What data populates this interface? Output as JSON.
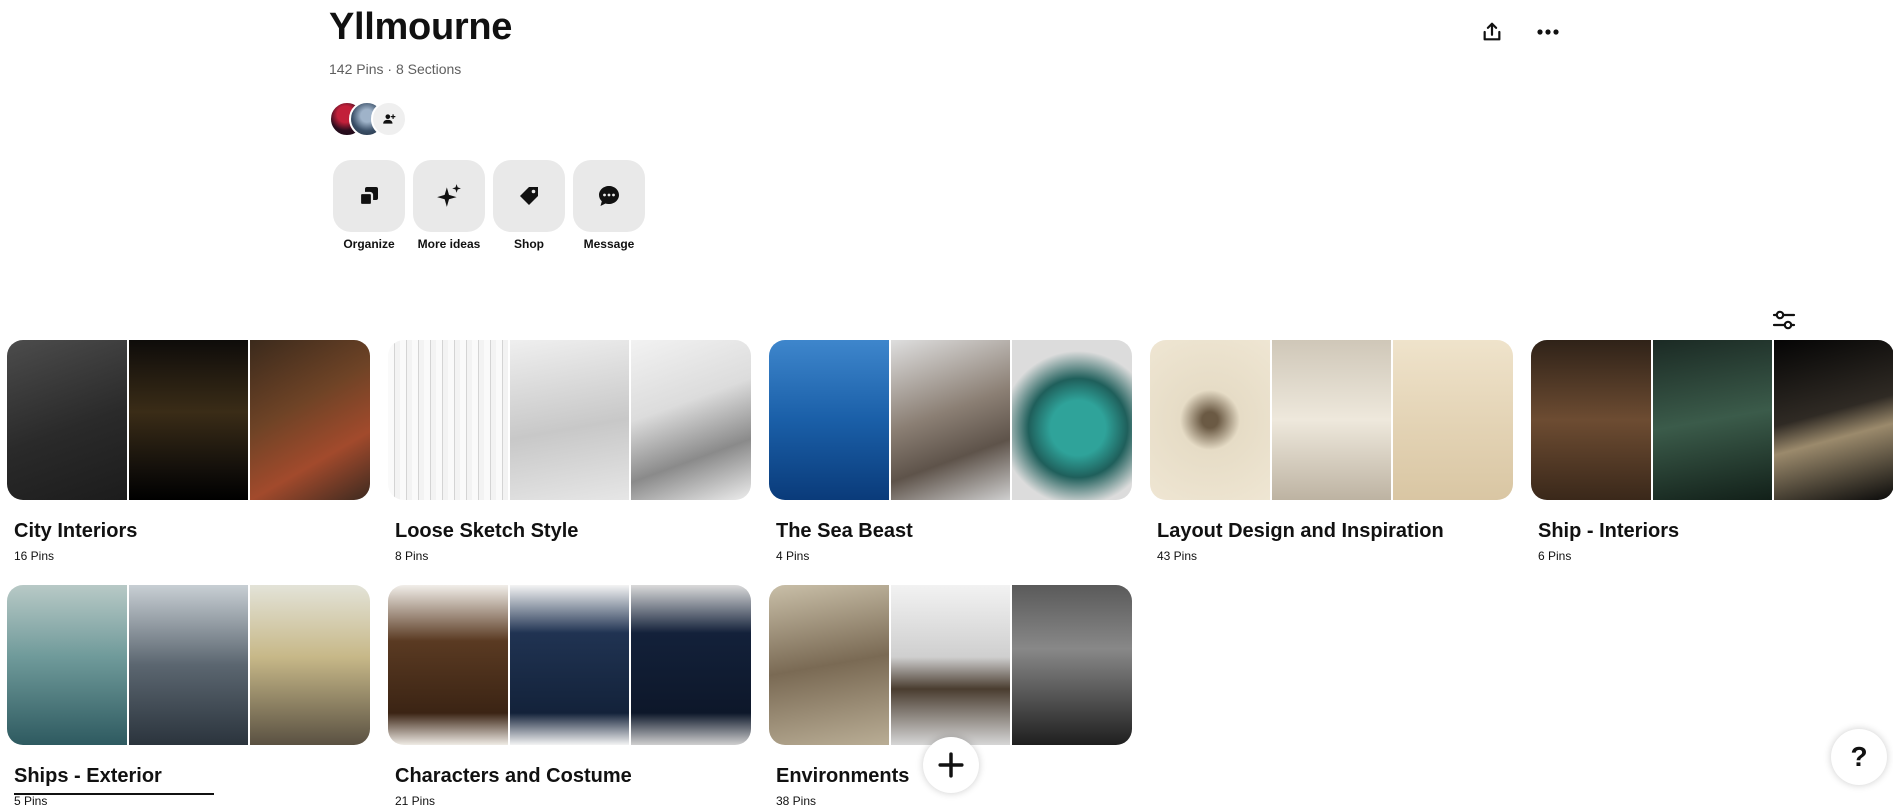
{
  "board": {
    "title": "Yllmourne",
    "pins_count": "142 Pins",
    "separator": "·",
    "sections_count": "8 Sections"
  },
  "header_icons": {
    "share": "share-icon",
    "more": "more-icon"
  },
  "tools": [
    {
      "label": "Organize",
      "icon": "organize-icon"
    },
    {
      "label": "More ideas",
      "icon": "sparkle-icon"
    },
    {
      "label": "Shop",
      "icon": "tag-icon"
    },
    {
      "label": "Message",
      "icon": "message-icon"
    }
  ],
  "sections": [
    {
      "title": "City Interiors",
      "count": "16 Pins"
    },
    {
      "title": "Loose Sketch Style",
      "count": "8 Pins"
    },
    {
      "title": "The Sea Beast",
      "count": "4 Pins"
    },
    {
      "title": "Layout Design and Inspiration",
      "count": "43 Pins"
    },
    {
      "title": "Ship - Interiors",
      "count": "6 Pins"
    },
    {
      "title": "Ships - Exterior",
      "count": "5 Pins"
    },
    {
      "title": "Characters and Costume",
      "count": "21 Pins"
    },
    {
      "title": "Environments",
      "count": "38 Pins"
    }
  ],
  "help_label": "?"
}
